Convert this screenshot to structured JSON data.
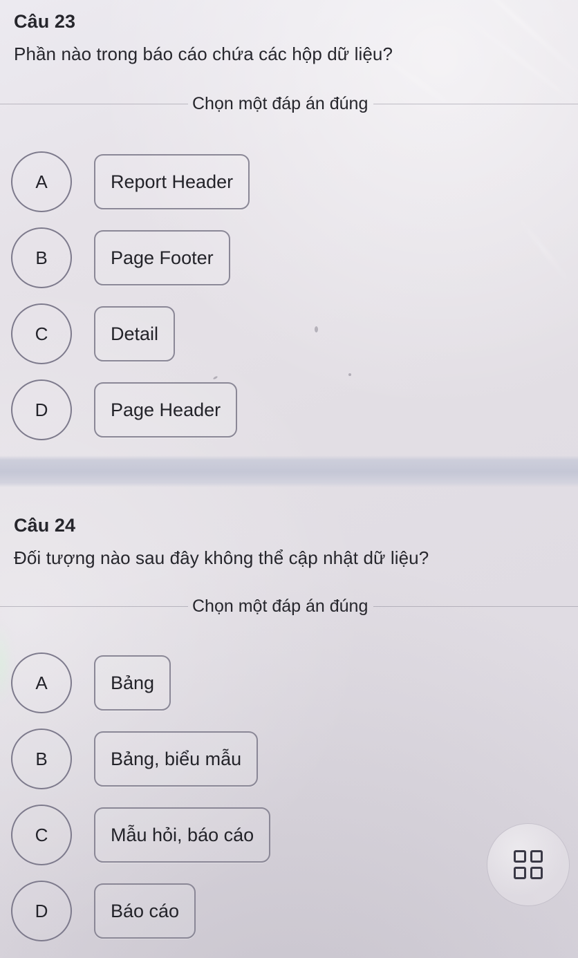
{
  "questions": [
    {
      "number": "Câu 23",
      "prompt": "Phần nào trong báo cáo chứa các hộp dữ liệu?",
      "choose_label": "Chọn một đáp án đúng",
      "options": [
        {
          "letter": "A",
          "label": "Report Header"
        },
        {
          "letter": "B",
          "label": "Page Footer"
        },
        {
          "letter": "C",
          "label": "Detail"
        },
        {
          "letter": "D",
          "label": "Page Header"
        }
      ]
    },
    {
      "number": "Câu 24",
      "prompt": "Đối tượng nào sau đây không thể cập nhật dữ liệu?",
      "choose_label": "Chọn một đáp án đúng",
      "options": [
        {
          "letter": "A",
          "label": "Bảng"
        },
        {
          "letter": "B",
          "label": "Bảng, biểu mẫu"
        },
        {
          "letter": "C",
          "label": "Mẫu hỏi, báo cáo"
        },
        {
          "letter": "D",
          "label": "Báo cáo"
        }
      ]
    }
  ],
  "floating_button": {
    "icon": "grid-2x2-icon"
  },
  "colors": {
    "background": "#e4e0e5",
    "text": "#26262c",
    "outline": "#8a8796",
    "divider_band": "#c5c7d6"
  }
}
